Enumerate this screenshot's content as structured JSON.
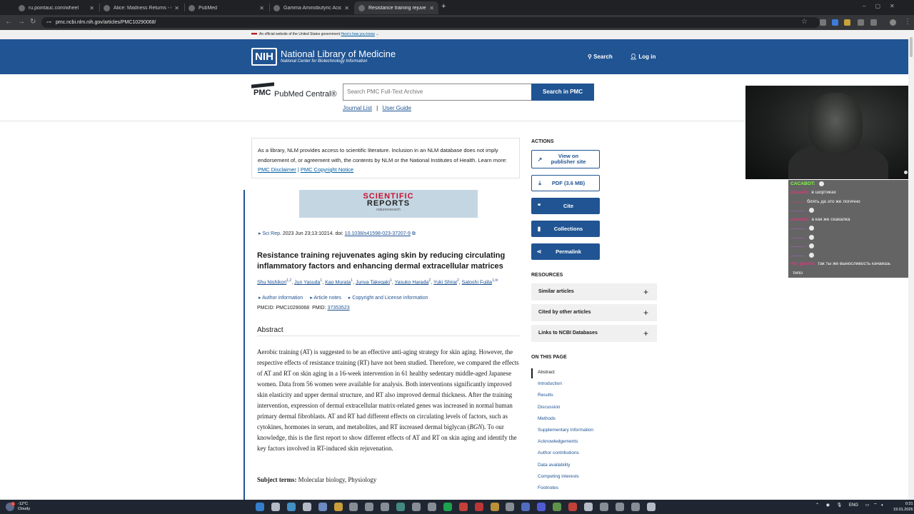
{
  "browser": {
    "tabs": [
      {
        "title": "ru.pointauc.com/wheel",
        "active": false
      },
      {
        "title": "Alice: Madness Returns - Goog",
        "active": false
      },
      {
        "title": "PubMed",
        "active": false
      },
      {
        "title": "Gamma Aminobutyric Acid-Enr",
        "active": false
      },
      {
        "title": "Resistance training rejuvenate",
        "active": true
      }
    ],
    "new_tab": "+",
    "url": "pmc.ncbi.nlm.nih.gov/articles/PMC10290068/"
  },
  "gov_banner": {
    "text": "An official website of the United States government",
    "link": "Here's how you know"
  },
  "header": {
    "logo": "NIH",
    "title": "National Library of Medicine",
    "subtitle": "National Center for Biotechnology Information",
    "search_label": "Search",
    "login_label": "Log in"
  },
  "pmc": {
    "logo": "PMC",
    "name": "PubMed Central®",
    "search_placeholder": "Search PMC Full-Text Archive",
    "search_button": "Search in PMC",
    "journal_list": "Journal List",
    "separator": "|",
    "user_guide": "User Guide"
  },
  "disclaimer": {
    "text": "As a library, NLM provides access to scientific literature. Inclusion in an NLM database does not imply endorsement of, or agreement with, the contents by NLM or the National Institutes of Health.",
    "learn_more": "Learn more:",
    "link1": "PMC Disclaimer",
    "sep": "|",
    "link2": "PMC Copyright Notice"
  },
  "journal": {
    "line1": "SCIENTIFIC",
    "line2": "REPORTS",
    "line3": "natureresearch"
  },
  "article": {
    "journal_abbrev": "Sci Rep",
    "citation": ". 2023 Jun 23;13:10214. doi: ",
    "doi": "10.1038/s41598-023-37207-9",
    "title": "Resistance training rejuvenates aging skin by reducing circulating inflammatory factors and enhancing dermal extracellular matrices",
    "authors": [
      {
        "name": "Shu Nishikori",
        "sup": "1,2"
      },
      {
        "name": "Jun Yasuda",
        "sup": "1"
      },
      {
        "name": "Kao Murata",
        "sup": "1"
      },
      {
        "name": "Junya Takegaki",
        "sup": "1"
      },
      {
        "name": "Yasuko Harada",
        "sup": "2"
      },
      {
        "name": "Yuki Shirai",
        "sup": "2"
      },
      {
        "name": "Satoshi Fujita",
        "sup": "1,✉"
      }
    ],
    "links": [
      "Author information",
      "Article notes",
      "Copyright and License information"
    ],
    "pmcid_label": "PMCID: PMC10290068",
    "pmid_label": "PMID:",
    "pmid": "37353523",
    "abstract_heading": "Abstract",
    "abstract_pre": "Aerobic training (AT) is suggested to be an effective anti-aging strategy for skin aging. However, the respective effects of resistance training (RT) have not been studied. Therefore, we compared the effects of AT and RT on skin aging in a 16-week intervention in 61 healthy sedentary middle-aged Japanese women. Data from 56 women were available for analysis. Both interventions significantly improved skin elasticity and upper dermal structure, and RT also improved dermal thickness. After the training intervention, expression of dermal extracellular matrix-related genes was increased in normal human primary dermal fibroblasts. AT and RT had different effects on circulating levels of factors, such as cytokines, hormones in serum, and metabolites, and RT increased dermal biglycan (",
    "abstract_gene": "BGN",
    "abstract_post": "). To our knowledge, this is the first report to show different effects of AT and RT on skin aging and identify the key factors involved in RT-induced skin rejuvenation.",
    "subject_label": "Subject terms:",
    "subject_terms": "Molecular biology, Physiology"
  },
  "actions": {
    "heading": "ACTIONS",
    "view_publisher": "View on publisher site",
    "pdf": "PDF (3.6 MB)",
    "cite": "Cite",
    "collections": "Collections",
    "permalink": "Permalink"
  },
  "resources": {
    "heading": "RESOURCES",
    "items": [
      "Similar articles",
      "Cited by other articles",
      "Links to NCBI Databases"
    ]
  },
  "on_this_page": {
    "heading": "ON THIS PAGE",
    "items": [
      "Abstract",
      "Introduction",
      "Results",
      "Discussion",
      "Methods",
      "Supplementary Information",
      "Acknowledgements",
      "Author contributions",
      "Data availability",
      "Competing interests",
      "Footnotes"
    ]
  },
  "chat": [
    {
      "user": "CACABOT:",
      "msg": "",
      "user_color": "#7fff3f",
      "emote": true
    },
    {
      "user": "alicashi:",
      "msg": "в шортиках",
      "user_color": "#d83a7c",
      "emote": false
    },
    {
      "user": "...........",
      "msg": "блять да это же логично",
      "user_color": "#d83a7c",
      "emote": false
    },
    {
      "user": "...........",
      "msg": "",
      "user_color": "#b060d0",
      "emote": true
    },
    {
      "user": "alicashi:",
      "msg": "а как же скакалка",
      "user_color": "#d83a7c",
      "emote": false
    },
    {
      "user": "...........",
      "msg": "",
      "user_color": "#b060d0",
      "emote": true
    },
    {
      "user": "...........",
      "msg": "",
      "user_color": "#b060d0",
      "emote": true
    },
    {
      "user": "...........",
      "msg": "",
      "user_color": "#b060d0",
      "emote": true
    },
    {
      "user": "...........",
      "msg": "",
      "user_color": "#b060d0",
      "emote": true
    },
    {
      "user": "vip_govno:",
      "msg": "так ты же выносливость качаешь",
      "user_color": "#d83a7c",
      "emote": false
    },
    {
      "user": "",
      "msg": "типо",
      "user_color": "#d83a7c",
      "emote": false
    }
  ],
  "taskbar": {
    "temp": "-12°C",
    "weather": "Cloudy",
    "lang": "ENG",
    "time": "0:31",
    "date": "19.01.2026"
  }
}
